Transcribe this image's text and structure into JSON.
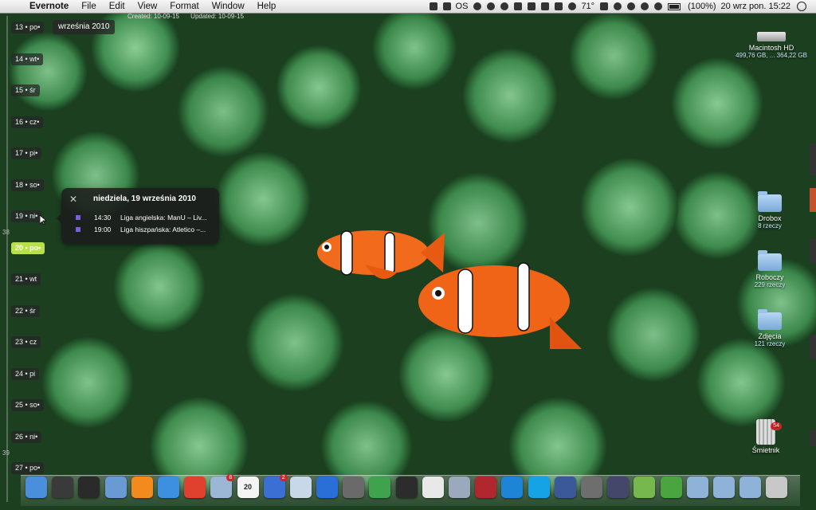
{
  "menubar": {
    "app_name": "Evernote",
    "menus": [
      "File",
      "Edit",
      "View",
      "Format",
      "Window",
      "Help"
    ],
    "status": {
      "temperature": "71°",
      "battery_text": "(100%)",
      "clock": "20 wrz pon.  15:22",
      "os_label": "OS"
    }
  },
  "window_strip": {
    "created": "Created: 10-09-15",
    "updated": "Updated: 10-09-15"
  },
  "calendar": {
    "month_label": "września 2010",
    "days": [
      {
        "label": "13 • po•",
        "today": false
      },
      {
        "label": "14 • wt•",
        "today": false
      },
      {
        "label": "15 • śr",
        "today": false
      },
      {
        "label": "16 • cz•",
        "today": false
      },
      {
        "label": "17 • pi•",
        "today": false
      },
      {
        "label": "18 • so•",
        "today": false
      },
      {
        "label": "19 • ni•",
        "today": false
      },
      {
        "label": "20 • po•",
        "today": true
      },
      {
        "label": "21 • wt",
        "today": false
      },
      {
        "label": "22 • śr",
        "today": false
      },
      {
        "label": "23 • cz",
        "today": false
      },
      {
        "label": "24 • pi",
        "today": false
      },
      {
        "label": "25 • so•",
        "today": false
      },
      {
        "label": "26 • ni•",
        "today": false
      },
      {
        "label": "27 • po•",
        "today": false
      }
    ],
    "side_markers": [
      "38",
      "39"
    ]
  },
  "popup": {
    "title": "niedziela, 19 września 2010",
    "events": [
      {
        "time": "14:30",
        "text": "Liga angielska: ManU – Liv..."
      },
      {
        "time": "19:00",
        "text": "Liga hiszpańska: Atletico –..."
      }
    ]
  },
  "desktop": {
    "hdd": {
      "label": "Macintosh HD",
      "sub": "499,76 GB, ... 364,22 GB"
    },
    "drobox": {
      "label": "Drobox",
      "sub": "8 rzeczy"
    },
    "roboczy": {
      "label": "Roboczy",
      "sub": "229 rzeczy"
    },
    "zdjecia": {
      "label": "Zdjęcia",
      "sub": "121 rzeczy"
    },
    "trash": {
      "label": "Śmietnik",
      "badge": "54"
    }
  },
  "dock": [
    {
      "name": "finder-icon",
      "color": "#4a8fdc"
    },
    {
      "name": "timemachine-icon",
      "color": "#3a3a3a"
    },
    {
      "name": "dashboard-icon",
      "color": "#2a2a2a"
    },
    {
      "name": "preview-icon",
      "color": "#6a9ad4"
    },
    {
      "name": "tweetdeck-icon",
      "color": "#f28a1e"
    },
    {
      "name": "safari-icon",
      "color": "#3d8fe0"
    },
    {
      "name": "chrome-icon",
      "color": "#e0402e"
    },
    {
      "name": "mail-icon",
      "color": "#9cb6d6",
      "badge": "8"
    },
    {
      "name": "ical-icon",
      "color": "#f4f4f4",
      "text": "20"
    },
    {
      "name": "things-icon",
      "color": "#3b6fd4",
      "badge": "2"
    },
    {
      "name": "iphoto-icon",
      "color": "#c9d8e8"
    },
    {
      "name": "itunes-icon",
      "color": "#2a6fd8"
    },
    {
      "name": "photo-icon",
      "color": "#6a6a6a"
    },
    {
      "name": "evernote-icon",
      "color": "#3fa34d"
    },
    {
      "name": "clapper-icon",
      "color": "#2c2c2c"
    },
    {
      "name": "textedit-icon",
      "color": "#e8e8e8"
    },
    {
      "name": "network-icon",
      "color": "#9aa9bb"
    },
    {
      "name": "pages-icon",
      "color": "#b0282e"
    },
    {
      "name": "skype-status-icon",
      "color": "#1e84d6"
    },
    {
      "name": "skype-icon",
      "color": "#16a3e6"
    },
    {
      "name": "facebook-icon",
      "color": "#3b5998"
    },
    {
      "name": "preferences-icon",
      "color": "#6e6e6e"
    },
    {
      "name": "pen-icon",
      "color": "#44476a"
    },
    {
      "name": "wunderkit-icon",
      "color": "#77b84e"
    },
    {
      "name": "syncing-icon",
      "color": "#4aa540"
    },
    {
      "name": "apps-folder-icon",
      "color": "#8fb3d8"
    },
    {
      "name": "documents-folder-icon",
      "color": "#8fb3d8"
    },
    {
      "name": "downloads-folder-icon",
      "color": "#8fb3d8"
    },
    {
      "name": "dock-trash-icon",
      "color": "#c8c8c8"
    }
  ]
}
